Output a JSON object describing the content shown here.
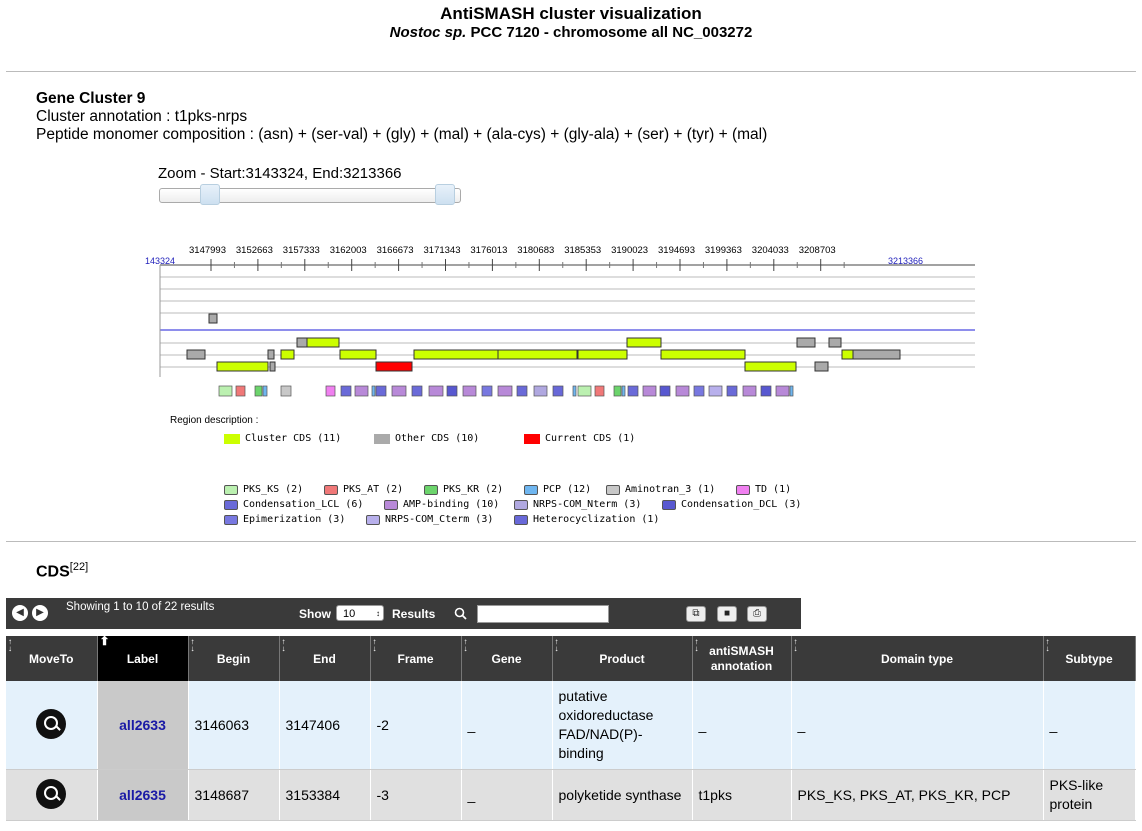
{
  "header": {
    "title": "AntiSMASH cluster visualization",
    "subtitle_italic": "Nostoc sp.",
    "subtitle_rest": "PCC 7120 - chromosome all NC_003272"
  },
  "cluster": {
    "heading": "Gene Cluster 9",
    "annotation": "Cluster annotation : t1pks-nrps",
    "composition": "Peptide monomer composition : (asn) + (ser-val) + (gly) + (mal) + (ala-cys) + (gly-ala) + (ser) + (tyr) + (mal)"
  },
  "zoom": {
    "label": "Zoom - Start:3143324, End:3213366",
    "start": 3143324,
    "end": 3213366
  },
  "ruler": {
    "start_label": "143324",
    "end_label": "3213366",
    "ticks": [
      "3147993",
      "3152663",
      "3157333",
      "3162003",
      "3166673",
      "3171343",
      "3176013",
      "3180683",
      "3185353",
      "3190023",
      "3194693",
      "3199363",
      "3204033",
      "3208703"
    ]
  },
  "legend": {
    "region_title": "Region description :",
    "cds": [
      {
        "label": "Cluster CDS (11)",
        "color": "#ccff00"
      },
      {
        "label": "Other CDS (10)",
        "color": "#aaaaaa"
      },
      {
        "label": "Current CDS (1)",
        "color": "#ff0000"
      }
    ],
    "domains": [
      {
        "label": "PKS_KS (2)",
        "color": "#bbf0b0"
      },
      {
        "label": "PKS_AT (2)",
        "color": "#f07878"
      },
      {
        "label": "PKS_KR (2)",
        "color": "#6cd46c"
      },
      {
        "label": "PCP (12)",
        "color": "#6fb6f0"
      },
      {
        "label": "Aminotran_3 (1)",
        "color": "#c8c8c8"
      },
      {
        "label": "TD (1)",
        "color": "#f080f0"
      },
      {
        "label": "Condensation_LCL (6)",
        "color": "#6a6ad8"
      },
      {
        "label": "AMP-binding (10)",
        "color": "#b889d8"
      },
      {
        "label": "NRPS-COM_Nterm (3)",
        "color": "#b0a8e0"
      },
      {
        "label": "Condensation_DCL (3)",
        "color": "#5858d0"
      },
      {
        "label": "Epimerization (3)",
        "color": "#7878e0"
      },
      {
        "label": "NRPS-COM_Cterm (3)",
        "color": "#b8b0ec"
      },
      {
        "label": "Heterocyclization (1)",
        "color": "#6868d8"
      }
    ]
  },
  "cds_section": {
    "title": "CDS",
    "count_sup": "[22]"
  },
  "toolbar": {
    "showing": "Showing 1 to 10 of 22 results",
    "show_label": "Show",
    "page_size": "10",
    "results_label": "Results",
    "search_value": ""
  },
  "table": {
    "columns": [
      "MoveTo",
      "Label",
      "Begin",
      "End",
      "Frame",
      "Gene",
      "Product",
      "antiSMASH annotation",
      "Domain type",
      "Subtype"
    ],
    "rows": [
      {
        "label": "all2633",
        "begin": "3146063",
        "end": "3147406",
        "frame": "-2",
        "gene": "_",
        "product": "putative oxidoreductase FAD/NAD(P)-binding",
        "annotation": "_",
        "domain_type": "_",
        "subtype": "_"
      },
      {
        "label": "all2635",
        "begin": "3148687",
        "end": "3153384",
        "frame": "-3",
        "gene": "_",
        "product": "polyketide synthase",
        "annotation": "t1pks",
        "domain_type": "PKS_KS, PKS_AT, PKS_KR, PCP",
        "subtype": "PKS-like protein"
      }
    ]
  },
  "colors": {
    "cluster_cds": "#ccff00",
    "other_cds": "#aaaaaa",
    "current_cds": "#ff0000",
    "header_bg": "#3a3a3a",
    "link": "#1a1aa6"
  },
  "icons": [
    "prev-page-icon",
    "next-page-icon",
    "search-icon",
    "copy-icon",
    "save-icon",
    "print-icon",
    "sort-arrows-icon",
    "magnifier-icon"
  ]
}
